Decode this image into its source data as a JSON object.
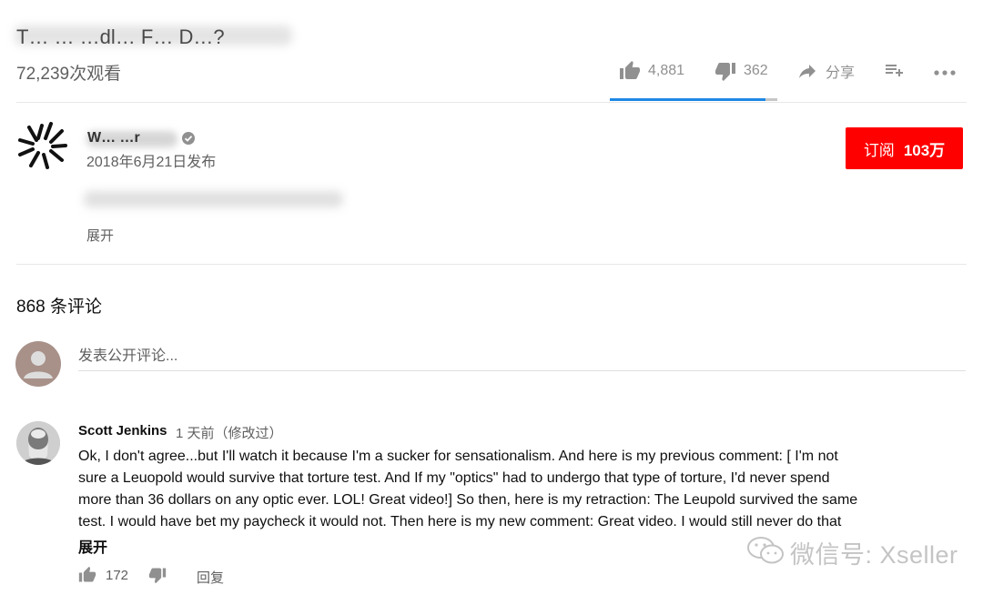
{
  "video": {
    "title": "T… … …dl… F… D…?",
    "views": "72,239次观看"
  },
  "actions": {
    "like_count": "4,881",
    "dislike_count": "362",
    "share_label": "分享",
    "like_ratio": 0.93
  },
  "channel": {
    "owner_name": "W… …r",
    "published": "2018年6月21日发布",
    "subscribe_label": "订阅",
    "subscriber_count": "103万"
  },
  "description": {
    "expand_label": "展开"
  },
  "comments": {
    "count_label": "868 条评论",
    "input_placeholder": "发表公开评论...",
    "items": [
      {
        "author": "Scott Jenkins",
        "time": "1 天前（修改过）",
        "lines": [
          "Ok, I don't agree...but I'll watch it because I'm a sucker for sensationalism.  And here is my previous comment: [ I'm not",
          "sure a Leuopold would survive that torture test.  And If my \"optics\" had to undergo that type of torture, I'd never spend",
          "more than 36 dollars on any optic ever.  LOL!  Great video!]  So then, here is my retraction:  The Leupold survived the same",
          "test.  I would have bet my paycheck it would not.  Then here is my new comment:  Great video.  I would still never do that"
        ],
        "expand_label": "展开",
        "like_count": "172",
        "reply_label": "回复"
      }
    ]
  },
  "watermark": {
    "text": "微信号: Xseller"
  },
  "colors": {
    "subscribe_bg": "#ff0000",
    "like_bar_fill": "#1e88e5",
    "like_bar_bg": "#c6c6c6",
    "icon_gray": "#909090"
  }
}
